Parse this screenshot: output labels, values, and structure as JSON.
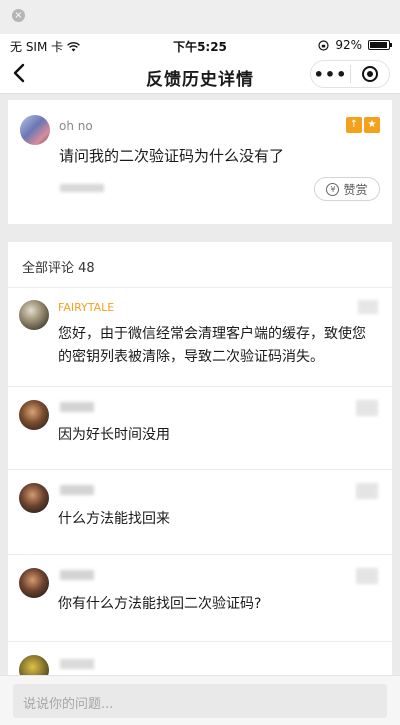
{
  "window": {
    "close_glyph": "×"
  },
  "status_bar": {
    "carrier": "无 SIM 卡",
    "time": "下午5:25",
    "battery": "92%",
    "icons": [
      "wifi-icon",
      "orientation-lock-icon",
      "battery-icon"
    ]
  },
  "nav": {
    "title": "反馈历史详情",
    "back_glyph": "‹",
    "more_glyph": "•••"
  },
  "post": {
    "username": "oh no",
    "question": "请问我的二次验证码为什么没有了",
    "badges": [
      "↑",
      "★"
    ],
    "like_label": "赞赏",
    "like_icon": "¥"
  },
  "comments": {
    "header": "全部评论 48",
    "items": [
      {
        "username": "FAIRYTALE",
        "username_color": "#f0a322",
        "text": "您好，由于微信经常会清理客户端的缓存，致使您的密钥列表被清除，导致二次验证码消失。"
      },
      {
        "username": "",
        "text": "因为好长时间没用"
      },
      {
        "username": "",
        "text": "什么方法能找回来"
      },
      {
        "username": "",
        "text": "你有什么方法能找回二次验证码?"
      }
    ]
  },
  "input": {
    "placeholder": "说说你的问题..."
  }
}
